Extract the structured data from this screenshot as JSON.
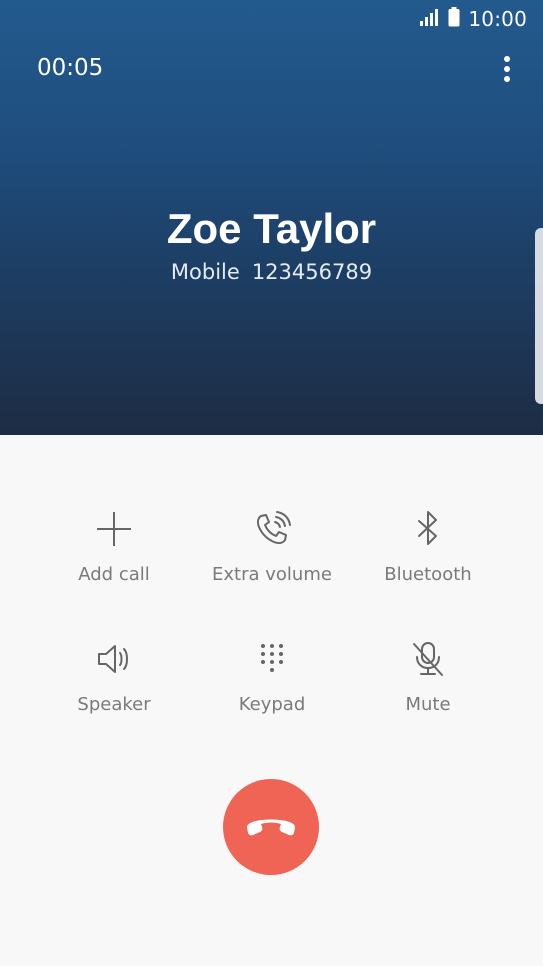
{
  "status_bar": {
    "time": "10:00",
    "signal_icon": "signal-icon",
    "battery_icon": "battery-icon"
  },
  "call": {
    "duration": "00:05",
    "caller_name": "Zoe Taylor",
    "number_type": "Mobile",
    "number": "123456789"
  },
  "actions": [
    {
      "label": "Add call",
      "icon": "plus-icon"
    },
    {
      "label": "Extra volume",
      "icon": "extra-volume-icon"
    },
    {
      "label": "Bluetooth",
      "icon": "bluetooth-icon"
    },
    {
      "label": "Speaker",
      "icon": "speaker-icon"
    },
    {
      "label": "Keypad",
      "icon": "keypad-icon"
    },
    {
      "label": "Mute",
      "icon": "mute-icon"
    }
  ],
  "end_call": {
    "icon": "end-call-icon",
    "color": "#ef6454"
  },
  "colors": {
    "header_top": "#235a8e",
    "header_bottom": "#1d2c44",
    "background": "#f8f8f8",
    "label_gray": "#7a7a7a"
  }
}
